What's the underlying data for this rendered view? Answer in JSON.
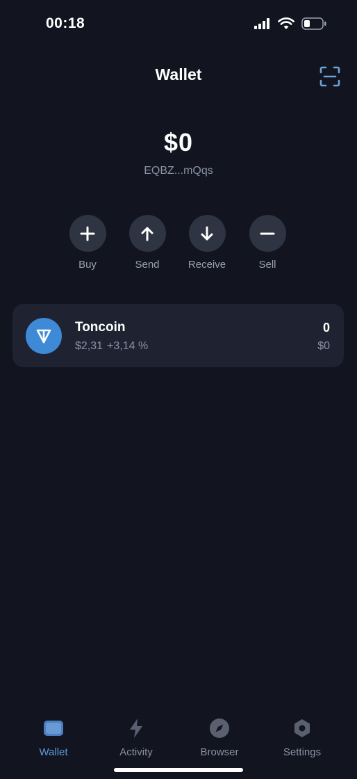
{
  "status_bar": {
    "time": "00:18"
  },
  "header": {
    "title": "Wallet"
  },
  "balance": {
    "amount": "$0",
    "address": "EQBZ...mQqs"
  },
  "actions": [
    {
      "label": "Buy",
      "icon": "plus-icon"
    },
    {
      "label": "Send",
      "icon": "arrow-up-icon"
    },
    {
      "label": "Receive",
      "icon": "arrow-down-icon"
    },
    {
      "label": "Sell",
      "icon": "minus-icon"
    }
  ],
  "tokens": [
    {
      "name": "Toncoin",
      "price": "$2,31",
      "change": "+3,14 %",
      "amount": "0",
      "value": "$0",
      "icon": "toncoin-logo-icon"
    }
  ],
  "tabs": [
    {
      "label": "Wallet",
      "icon": "wallet-icon",
      "active": true
    },
    {
      "label": "Activity",
      "icon": "lightning-icon",
      "active": false
    },
    {
      "label": "Browser",
      "icon": "compass-icon",
      "active": false
    },
    {
      "label": "Settings",
      "icon": "gear-icon",
      "active": false
    }
  ],
  "colors": {
    "background": "#12151f",
    "card": "#1f2331",
    "action_circle": "#2f3443",
    "accent": "#3e8ad6",
    "active_tab": "#5b9be0",
    "secondary_text": "#8a92a6"
  }
}
